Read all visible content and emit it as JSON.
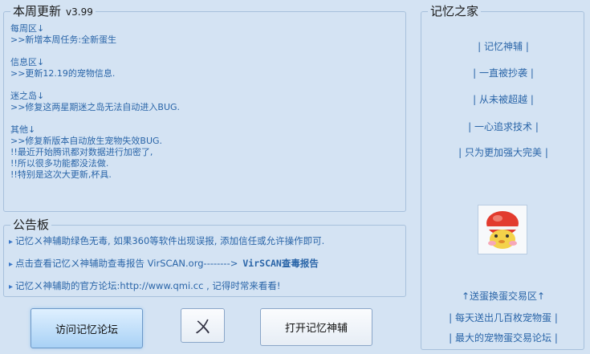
{
  "updates": {
    "title": "本周更新",
    "version": "v3.99",
    "sections": [
      {
        "lines": [
          "每周区↓",
          ">>新增本周任务:全新蛋生"
        ]
      },
      {
        "lines": [
          "信息区↓",
          ">>更新12.19的宠物信息."
        ]
      },
      {
        "lines": [
          "迷之岛↓",
          ">>修复这两星期迷之岛无法自动进入BUG."
        ]
      },
      {
        "lines": [
          "其他↓",
          ">>修复新版本自动放生宠物失效BUG.",
          "!!最近开始腾讯都对数据进行加密了,",
          "!!所以很多功能都没法做.",
          "!!特别是这次大更新,杯具."
        ]
      }
    ]
  },
  "notice": {
    "title": "公告板",
    "lines": [
      {
        "text": "记忆ㄨ神辅助绿色无毒, 如果360等软件出现误报, 添加信任或允许操作即可.",
        "extra": ""
      },
      {
        "text": "点击查看记忆ㄨ神辅助查毒报告 VirSCAN.org-------->",
        "extra": "VirSCAN查毒报告"
      },
      {
        "text": "记忆ㄨ神辅助的官方论坛:http://www.qmi.cc , 记得时常来看看!",
        "extra": ""
      }
    ]
  },
  "home": {
    "title": "记忆之家",
    "mottos": [
      "| 记忆神辅 |",
      "| 一直被抄袭 |",
      "| 从未被超越 |",
      "| 一心追求技术 |",
      "| 只为更加强大完美 |"
    ],
    "trade": [
      "↑送蛋换蛋交易区↑",
      "| 每天送出几百枚宠物蛋 |",
      "| 最大的宠物蛋交易论坛 |"
    ]
  },
  "buttons": {
    "forum": "访问记忆论坛",
    "close": "ㄨ",
    "open": "打开记忆神辅"
  },
  "colors": {
    "background": "#d4e3f3",
    "text": "#2a65a8",
    "border": "#a7c0dc"
  },
  "icons": {
    "notice_bullet": "chevron-right-icon",
    "pet": "pet-avatar-icon"
  }
}
